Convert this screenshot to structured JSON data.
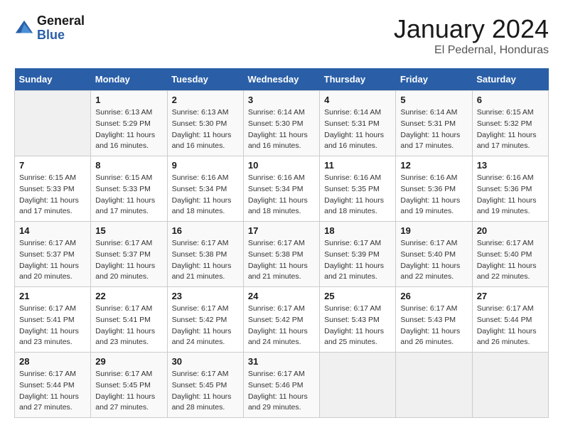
{
  "logo": {
    "line1": "General",
    "line2": "Blue"
  },
  "title": "January 2024",
  "subtitle": "El Pedernal, Honduras",
  "header_days": [
    "Sunday",
    "Monday",
    "Tuesday",
    "Wednesday",
    "Thursday",
    "Friday",
    "Saturday"
  ],
  "weeks": [
    [
      {
        "day": "",
        "info": ""
      },
      {
        "day": "1",
        "info": "Sunrise: 6:13 AM\nSunset: 5:29 PM\nDaylight: 11 hours and 16 minutes."
      },
      {
        "day": "2",
        "info": "Sunrise: 6:13 AM\nSunset: 5:30 PM\nDaylight: 11 hours and 16 minutes."
      },
      {
        "day": "3",
        "info": "Sunrise: 6:14 AM\nSunset: 5:30 PM\nDaylight: 11 hours and 16 minutes."
      },
      {
        "day": "4",
        "info": "Sunrise: 6:14 AM\nSunset: 5:31 PM\nDaylight: 11 hours and 16 minutes."
      },
      {
        "day": "5",
        "info": "Sunrise: 6:14 AM\nSunset: 5:31 PM\nDaylight: 11 hours and 17 minutes."
      },
      {
        "day": "6",
        "info": "Sunrise: 6:15 AM\nSunset: 5:32 PM\nDaylight: 11 hours and 17 minutes."
      }
    ],
    [
      {
        "day": "7",
        "info": "Sunrise: 6:15 AM\nSunset: 5:33 PM\nDaylight: 11 hours and 17 minutes."
      },
      {
        "day": "8",
        "info": "Sunrise: 6:15 AM\nSunset: 5:33 PM\nDaylight: 11 hours and 17 minutes."
      },
      {
        "day": "9",
        "info": "Sunrise: 6:16 AM\nSunset: 5:34 PM\nDaylight: 11 hours and 18 minutes."
      },
      {
        "day": "10",
        "info": "Sunrise: 6:16 AM\nSunset: 5:34 PM\nDaylight: 11 hours and 18 minutes."
      },
      {
        "day": "11",
        "info": "Sunrise: 6:16 AM\nSunset: 5:35 PM\nDaylight: 11 hours and 18 minutes."
      },
      {
        "day": "12",
        "info": "Sunrise: 6:16 AM\nSunset: 5:36 PM\nDaylight: 11 hours and 19 minutes."
      },
      {
        "day": "13",
        "info": "Sunrise: 6:16 AM\nSunset: 5:36 PM\nDaylight: 11 hours and 19 minutes."
      }
    ],
    [
      {
        "day": "14",
        "info": "Sunrise: 6:17 AM\nSunset: 5:37 PM\nDaylight: 11 hours and 20 minutes."
      },
      {
        "day": "15",
        "info": "Sunrise: 6:17 AM\nSunset: 5:37 PM\nDaylight: 11 hours and 20 minutes."
      },
      {
        "day": "16",
        "info": "Sunrise: 6:17 AM\nSunset: 5:38 PM\nDaylight: 11 hours and 21 minutes."
      },
      {
        "day": "17",
        "info": "Sunrise: 6:17 AM\nSunset: 5:38 PM\nDaylight: 11 hours and 21 minutes."
      },
      {
        "day": "18",
        "info": "Sunrise: 6:17 AM\nSunset: 5:39 PM\nDaylight: 11 hours and 21 minutes."
      },
      {
        "day": "19",
        "info": "Sunrise: 6:17 AM\nSunset: 5:40 PM\nDaylight: 11 hours and 22 minutes."
      },
      {
        "day": "20",
        "info": "Sunrise: 6:17 AM\nSunset: 5:40 PM\nDaylight: 11 hours and 22 minutes."
      }
    ],
    [
      {
        "day": "21",
        "info": "Sunrise: 6:17 AM\nSunset: 5:41 PM\nDaylight: 11 hours and 23 minutes."
      },
      {
        "day": "22",
        "info": "Sunrise: 6:17 AM\nSunset: 5:41 PM\nDaylight: 11 hours and 23 minutes."
      },
      {
        "day": "23",
        "info": "Sunrise: 6:17 AM\nSunset: 5:42 PM\nDaylight: 11 hours and 24 minutes."
      },
      {
        "day": "24",
        "info": "Sunrise: 6:17 AM\nSunset: 5:42 PM\nDaylight: 11 hours and 24 minutes."
      },
      {
        "day": "25",
        "info": "Sunrise: 6:17 AM\nSunset: 5:43 PM\nDaylight: 11 hours and 25 minutes."
      },
      {
        "day": "26",
        "info": "Sunrise: 6:17 AM\nSunset: 5:43 PM\nDaylight: 11 hours and 26 minutes."
      },
      {
        "day": "27",
        "info": "Sunrise: 6:17 AM\nSunset: 5:44 PM\nDaylight: 11 hours and 26 minutes."
      }
    ],
    [
      {
        "day": "28",
        "info": "Sunrise: 6:17 AM\nSunset: 5:44 PM\nDaylight: 11 hours and 27 minutes."
      },
      {
        "day": "29",
        "info": "Sunrise: 6:17 AM\nSunset: 5:45 PM\nDaylight: 11 hours and 27 minutes."
      },
      {
        "day": "30",
        "info": "Sunrise: 6:17 AM\nSunset: 5:45 PM\nDaylight: 11 hours and 28 minutes."
      },
      {
        "day": "31",
        "info": "Sunrise: 6:17 AM\nSunset: 5:46 PM\nDaylight: 11 hours and 29 minutes."
      },
      {
        "day": "",
        "info": ""
      },
      {
        "day": "",
        "info": ""
      },
      {
        "day": "",
        "info": ""
      }
    ]
  ]
}
